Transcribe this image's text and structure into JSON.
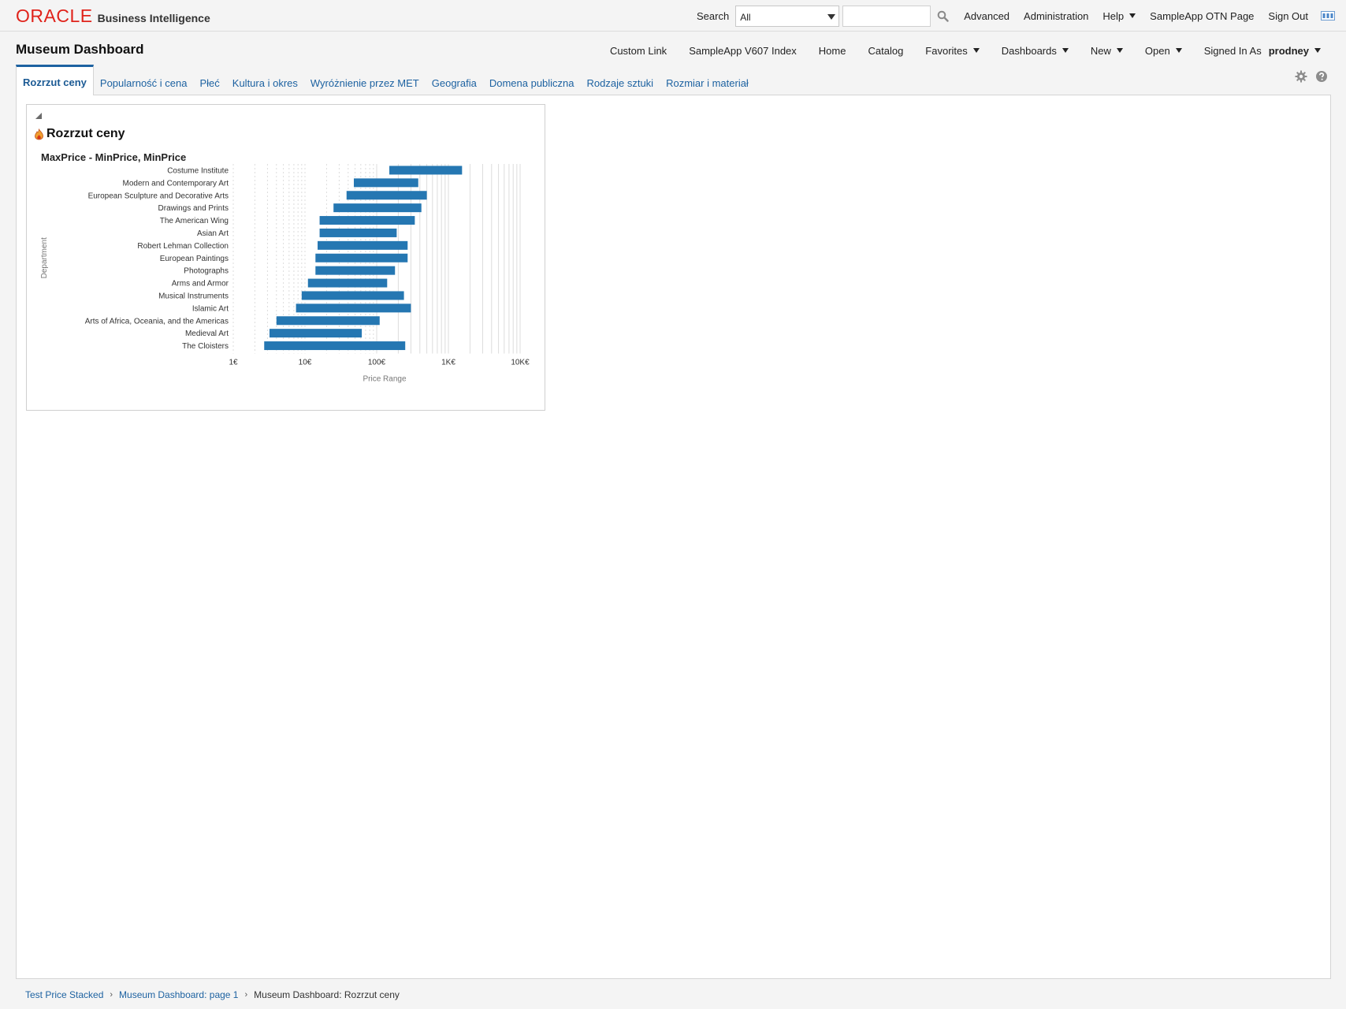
{
  "brand": {
    "oracle": "ORACLE",
    "product": "Business Intelligence"
  },
  "global_bar": {
    "search_label": "Search",
    "search_scope": "All",
    "search_placeholder": "",
    "links": [
      "Advanced",
      "Administration",
      "Help",
      "SampleApp OTN Page",
      "Sign Out"
    ]
  },
  "dashboard": {
    "title": "Museum Dashboard",
    "nav": {
      "custom_link": "Custom Link",
      "sampleapp_index": "SampleApp V607 Index",
      "home": "Home",
      "catalog": "Catalog",
      "favorites": "Favorites",
      "dashboards": "Dashboards",
      "new": "New",
      "open": "Open",
      "signed_in_as": "Signed In As",
      "user": "prodney"
    }
  },
  "tabs": [
    "Rozrzut ceny",
    "Popularność i cena",
    "Płeć",
    "Kultura i okres",
    "Wyróżnienie przez MET",
    "Geografia",
    "Domena publiczna",
    "Rodzaje sztuki",
    "Rozmiar i materiał"
  ],
  "panel": {
    "title": "Rozrzut ceny"
  },
  "chart_data": {
    "type": "bar",
    "orientation": "horizontal",
    "stacked_range": true,
    "title": "MaxPrice - MinPrice, MinPrice",
    "xlabel": "Price Range",
    "ylabel": "Department",
    "x_scale": "log",
    "xlim": [
      1,
      10000
    ],
    "x_ticks": [
      "1€",
      "10€",
      "100€",
      "1K€",
      "10K€"
    ],
    "grid": true,
    "bar_color": "#2577b2",
    "categories": [
      "Costume Institute",
      "Modern and Contemporary Art",
      "European Sculpture and Decorative Arts",
      "Drawings and Prints",
      "The American Wing",
      "Asian Art",
      "Robert Lehman Collection",
      "European Paintings",
      "Photographs",
      "Arms and Armor",
      "Musical Instruments",
      "Islamic Art",
      "Arts of Africa, Oceania, and the Americas",
      "Medieval Art",
      "The Cloisters"
    ],
    "series": [
      {
        "name": "MinPrice",
        "values": [
          150,
          48,
          38,
          25,
          16,
          16,
          15,
          14,
          14,
          11,
          9,
          7.5,
          4,
          3.2,
          2.7
        ]
      },
      {
        "name": "MaxPrice",
        "values": [
          1550,
          380,
          500,
          420,
          340,
          190,
          270,
          270,
          180,
          140,
          240,
          300,
          110,
          62,
          250
        ]
      }
    ]
  },
  "breadcrumb": [
    "Test Price Stacked",
    "Museum Dashboard: page 1",
    "Museum Dashboard: Rozrzut ceny"
  ]
}
